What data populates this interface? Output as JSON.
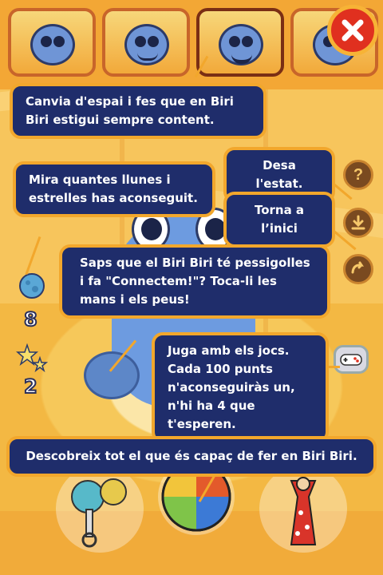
{
  "tips": {
    "change_space": "Canvia d'espai i fes que en Biri Biri estigui sempre content.",
    "moons_stars": "Mira quantes llunes i estrelles has aconseguit.",
    "save_state": "Desa l'estat.",
    "back_home": "Torna a l’inici",
    "tickles": "Saps que el Biri Biri té pessigolles i fa \"Connectem!\"? Toca-li les mans i els peus!",
    "games": "Juga amb els jocs. Cada 100  punts n'aconseguiràs un, n'hi ha 4 que t'esperen.",
    "discover": "Descobreix tot el que és capaç de fer en Biri Biri."
  },
  "counters": {
    "moons": "8",
    "stars": "2"
  },
  "rooms": [
    "sad-room-icon",
    "kitchen-room-icon",
    "bath-room-icon",
    "night-room-icon"
  ],
  "side_buttons": {
    "help": "?"
  },
  "colors": {
    "bubble_bg": "#1f2d6b",
    "bubble_border": "#f2a72c",
    "close_red": "#e0301f"
  }
}
